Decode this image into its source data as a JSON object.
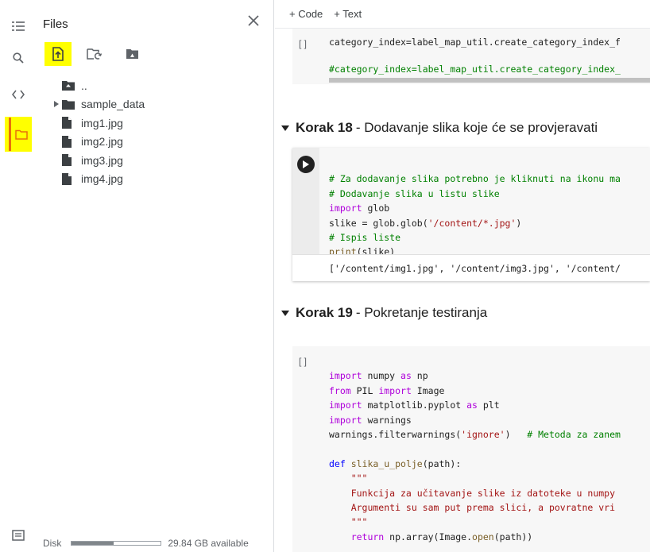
{
  "sidebar": {
    "icons": [
      "toc-icon",
      "search-icon",
      "code-snippets-icon",
      "folder-icon"
    ],
    "bottom_icon": "terminal-icon"
  },
  "files": {
    "title": "Files",
    "tree": [
      {
        "label": "..",
        "icon": "folder-up-icon"
      },
      {
        "label": "sample_data",
        "icon": "folder-icon"
      },
      {
        "label": "img1.jpg",
        "icon": "file-icon"
      },
      {
        "label": "img2.jpg",
        "icon": "file-icon"
      },
      {
        "label": "img3.jpg",
        "icon": "file-icon"
      },
      {
        "label": "img4.jpg",
        "icon": "file-icon"
      }
    ],
    "disk_label": "Disk",
    "disk_available": "29.84 GB available",
    "disk_used_fraction": 0.47
  },
  "toolbar": {
    "code_label": "+ Code",
    "text_label": "+ Text"
  },
  "cells": {
    "cell1": {
      "bracket": "[ ]",
      "line1": "category_index=label_map_util.create_category_index_f",
      "line2": "#category_index=label_map_util.create_category_index_"
    },
    "heading18": {
      "prefix": "Korak 18",
      "rest": " - Dodavanje slika koje će se provjeravati"
    },
    "cell2": {
      "line1": "# Za dodavanje slika potrebno je kliknuti na ikonu ma",
      "line2": "# Dodavanje slika u listu slike",
      "line3_kw": "import",
      "line3_rest": " glob",
      "line4_a": "slike = glob.glob(",
      "line4_str": "'/content/*.jpg'",
      "line4_b": ")",
      "line5": "# Ispis liste",
      "line6_fn": "print",
      "line6_rest": "(slike)",
      "output": "['/content/img1.jpg', '/content/img3.jpg', '/content/"
    },
    "heading19": {
      "prefix": "Korak 19",
      "rest": " - Pokretanje testiranja"
    },
    "cell3": {
      "bracket": "[ ]",
      "l1_kw": "import",
      "l1_rest": " numpy ",
      "l1_as": "as",
      "l1_end": " np",
      "l2_kw": "from",
      "l2_mid": " PIL ",
      "l2_imp": "import",
      "l2_end": " Image",
      "l3_kw": "import",
      "l3_rest": " matplotlib.pyplot ",
      "l3_as": "as",
      "l3_end": " plt",
      "l4_kw": "import",
      "l4_rest": " warnings",
      "l5_a": "warnings.filterwarnings(",
      "l5_str": "'ignore'",
      "l5_b": ")   ",
      "l5_cm": "# Metoda za zanem",
      "l6_kw": "def",
      "l6_fn": " slika_u_polje",
      "l6_rest": "(path):",
      "l7": "    \"\"\"",
      "l8": "    Funkcija za učitavanje slike iz datoteke u numpy",
      "l9": "    Argumenti su sam put prema slici, a povratne vri",
      "l10": "    \"\"\"",
      "l11_kw": "    return",
      "l11_a": " np.array(Image.",
      "l11_fn": "open",
      "l11_b": "(path))"
    }
  }
}
